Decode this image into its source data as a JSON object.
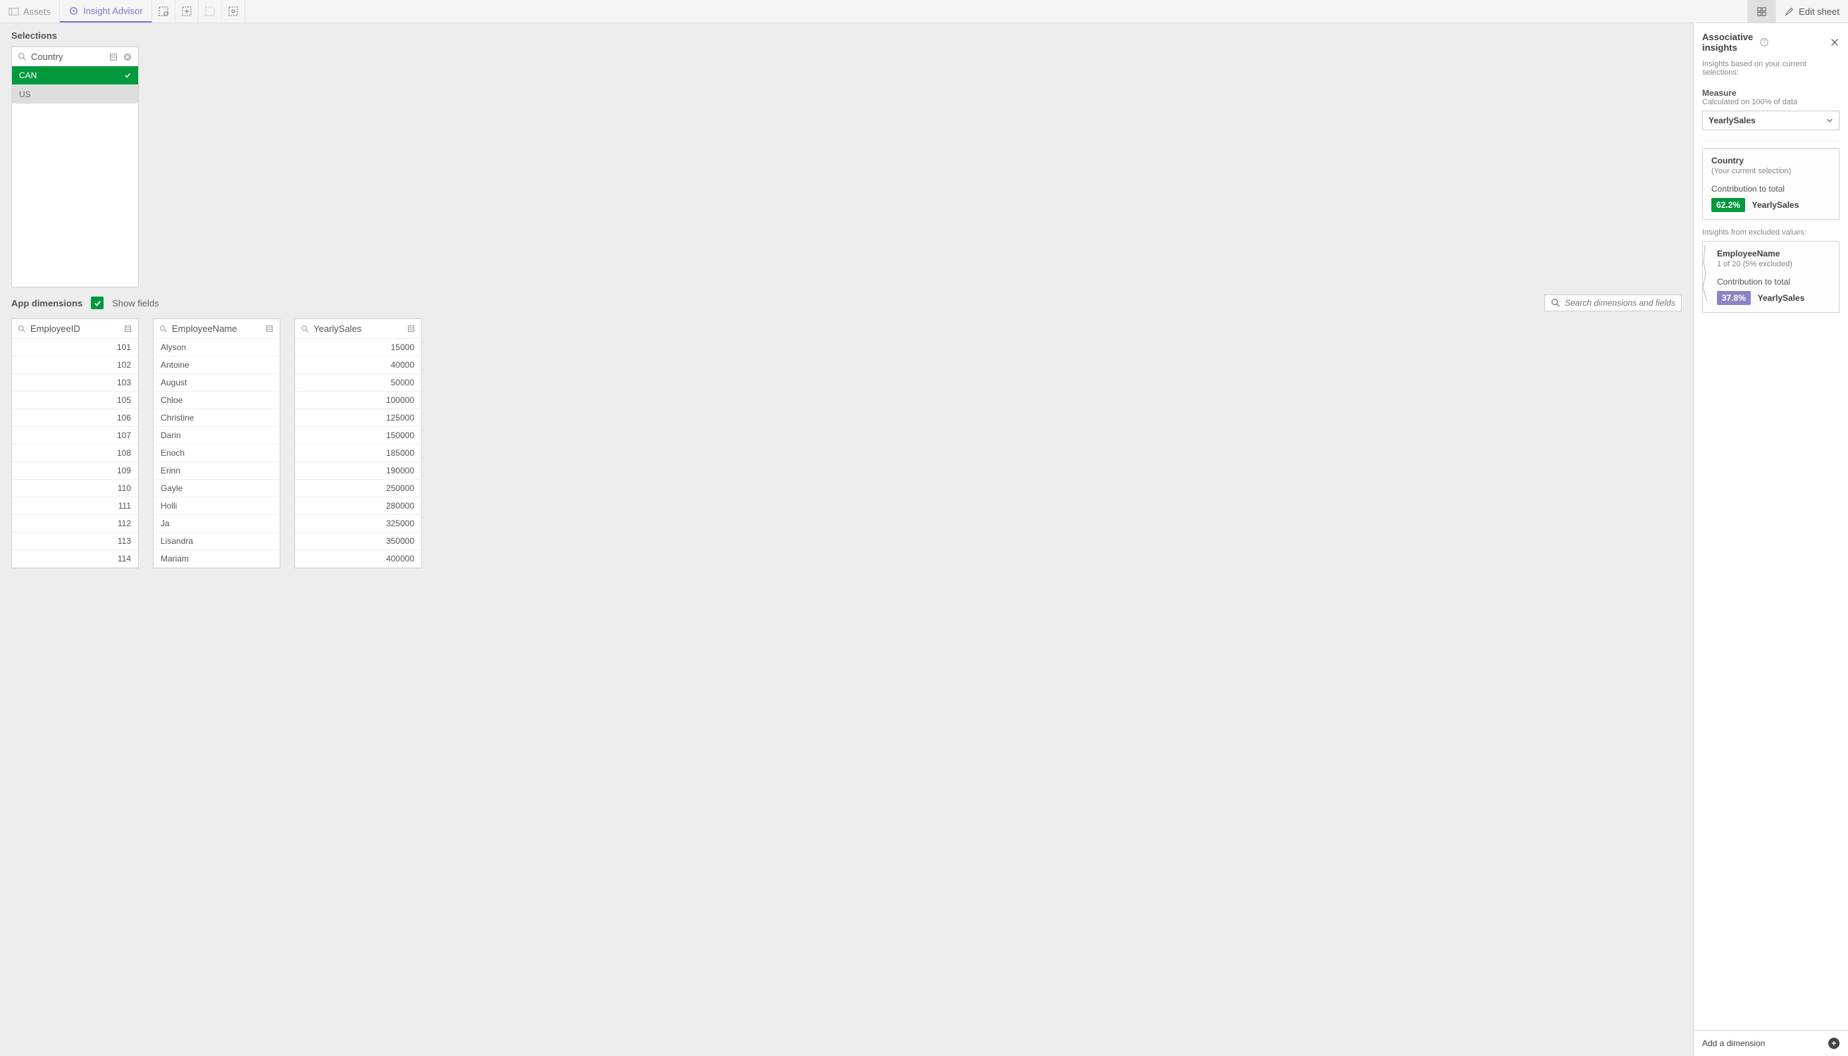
{
  "toolbar": {
    "assets": "Assets",
    "insight_advisor": "Insight Advisor",
    "edit_sheet": "Edit sheet"
  },
  "selections": {
    "title": "Selections",
    "field": "Country",
    "items": [
      {
        "label": "CAN",
        "state": "selected"
      },
      {
        "label": "US",
        "state": "alt"
      }
    ]
  },
  "app_dimensions": {
    "title": "App dimensions",
    "show_fields": "Show fields",
    "search_placeholder": "Search dimensions and fields"
  },
  "dim_cards": [
    {
      "name": "EmployeeID",
      "align": "right",
      "values": [
        "101",
        "102",
        "103",
        "105",
        "106",
        "107",
        "108",
        "109",
        "110",
        "111",
        "112",
        "113",
        "114"
      ]
    },
    {
      "name": "EmployeeName",
      "align": "left",
      "values": [
        "Alyson",
        "Antoine",
        "August",
        "Chloe",
        "Christine",
        "Darin",
        "Enoch",
        "Erinn",
        "Gayle",
        "Holli",
        "Ja",
        "Lisandra",
        "Mariam"
      ]
    },
    {
      "name": "YearlySales",
      "align": "right",
      "values": [
        "15000",
        "40000",
        "50000",
        "100000",
        "125000",
        "150000",
        "185000",
        "190000",
        "250000",
        "280000",
        "325000",
        "350000",
        "400000"
      ]
    }
  ],
  "insights": {
    "title": "Associative insights",
    "subtitle": "Insights based on your current selections:",
    "measure_label": "Measure",
    "measure_note": "Calculated on 100% of data",
    "measure_value": "YearlySales",
    "card_selection": {
      "title": "Country",
      "sub": "(Your current selection)",
      "contrib_label": "Contribution to total",
      "pct": "62.2%",
      "measure": "YearlySales"
    },
    "excluded_title": "Insights from excluded values:",
    "card_excluded": {
      "title": "EmployeeName",
      "sub": "1 of 20 (5% excluded)",
      "contrib_label": "Contribution to total",
      "pct": "37.8%",
      "measure": "YearlySales"
    },
    "add_dimension": "Add a dimension"
  }
}
